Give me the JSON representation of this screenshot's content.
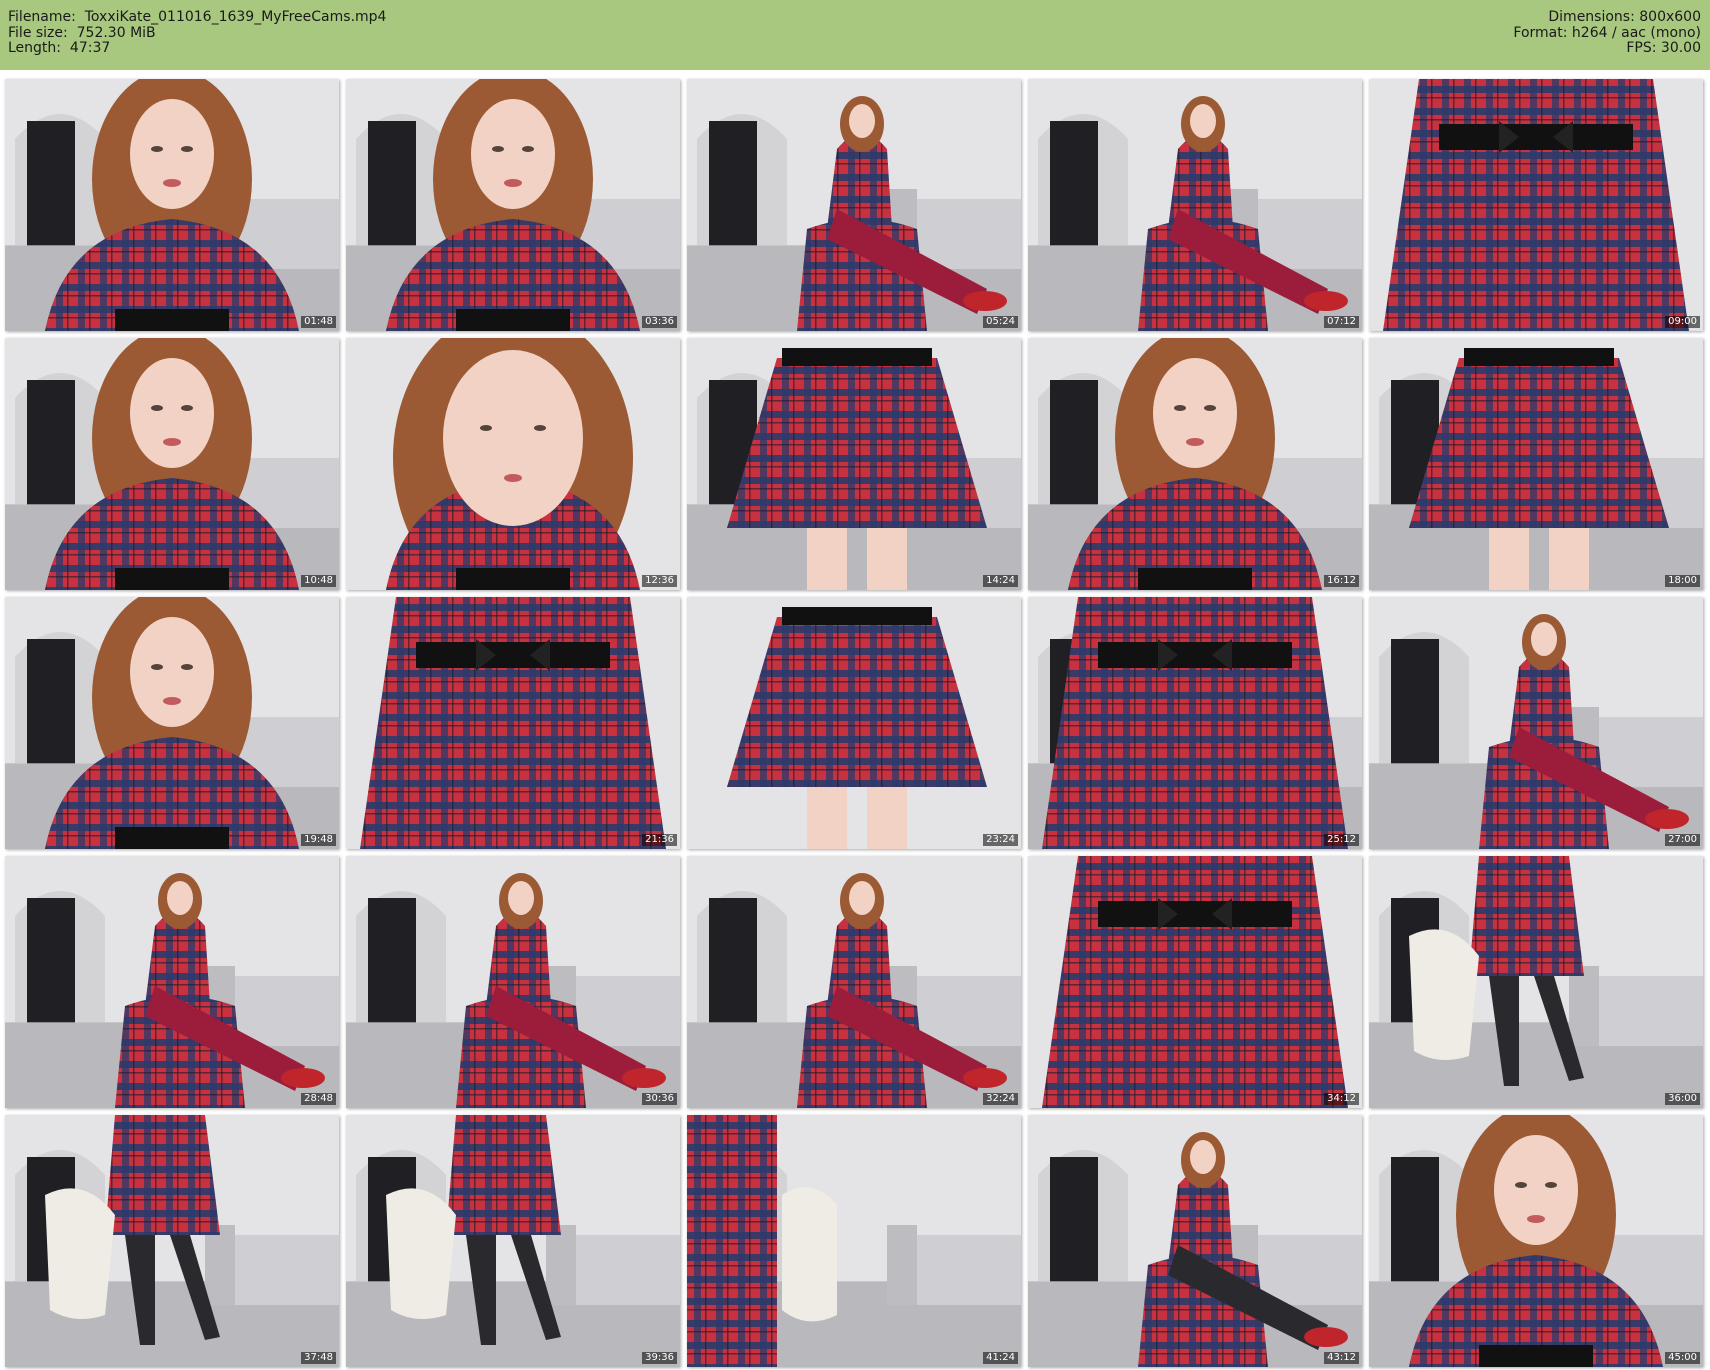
{
  "header": {
    "left": [
      "Filename:  ToxxiKate_011016_1639_MyFreeCams.mp4",
      "File size:  752.30 MiB",
      "Length:  47:37"
    ],
    "right": [
      "Dimensions: 800x600",
      "Format: h264 / aac (mono)",
      "FPS: 30.00"
    ]
  },
  "thumbnails": [
    {
      "time": "01:48",
      "scene": "face-closeup"
    },
    {
      "time": "03:36",
      "scene": "face-closeup"
    },
    {
      "time": "05:24",
      "scene": "seated-red-stockings"
    },
    {
      "time": "07:12",
      "scene": "seated-red-stockings"
    },
    {
      "time": "09:00",
      "scene": "dress-closeup"
    },
    {
      "time": "10:48",
      "scene": "face-closeup"
    },
    {
      "time": "12:36",
      "scene": "face-tight"
    },
    {
      "time": "14:24",
      "scene": "skirt-back"
    },
    {
      "time": "16:12",
      "scene": "face-closeup"
    },
    {
      "time": "18:00",
      "scene": "skirt-back"
    },
    {
      "time": "19:48",
      "scene": "face-closeup"
    },
    {
      "time": "21:36",
      "scene": "dress-closeup"
    },
    {
      "time": "23:24",
      "scene": "skirt-low"
    },
    {
      "time": "25:12",
      "scene": "dress-standing"
    },
    {
      "time": "27:00",
      "scene": "seated-red-stockings"
    },
    {
      "time": "28:48",
      "scene": "seated-red-stockings"
    },
    {
      "time": "30:36",
      "scene": "seated-red-stockings"
    },
    {
      "time": "32:24",
      "scene": "seated-red-stockings"
    },
    {
      "time": "34:12",
      "scene": "dress-closeup"
    },
    {
      "time": "36:00",
      "scene": "standing-black-stockings"
    },
    {
      "time": "37:48",
      "scene": "standing-black-stockings"
    },
    {
      "time": "39:36",
      "scene": "standing-black-stockings"
    },
    {
      "time": "41:24",
      "scene": "room-empty"
    },
    {
      "time": "43:12",
      "scene": "seated-black-stockings"
    },
    {
      "time": "45:00",
      "scene": "face-closeup"
    }
  ],
  "colors": {
    "header_bg": "#a9c87f",
    "plaid_red": "#c8313f",
    "plaid_navy": "#2b3a6b",
    "stocking_red": "#9b1c3b",
    "stocking_black": "#2a2a2e",
    "wall": "#e4e4e6",
    "floor": "#b9b9bd"
  }
}
